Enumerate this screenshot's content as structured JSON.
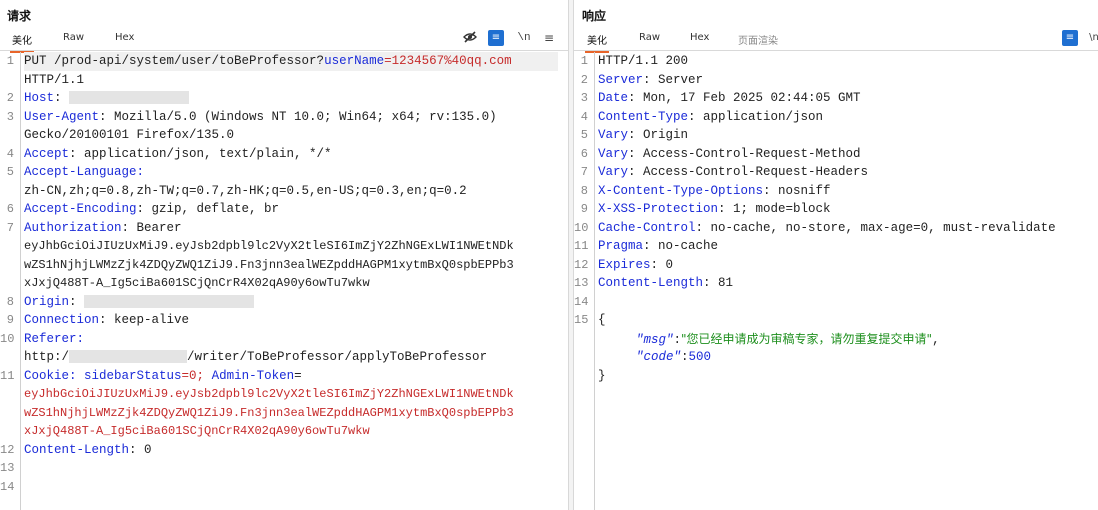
{
  "request": {
    "title": "请求",
    "tabs": [
      "美化",
      "Raw",
      "Hex"
    ],
    "line_numbers": [
      "1",
      "2",
      "3",
      "4",
      "5",
      "6",
      "7",
      "8",
      "9",
      "10",
      "11",
      "12",
      "13",
      "14"
    ],
    "lines": {
      "l1_method": "PUT /prod-api/system/user/toBeProfessor?",
      "l1_param": "userName",
      "l1_value": "=1234567%40qq.com",
      "l1_cont": "HTTP/1.1",
      "l2_key": "Host",
      "l3_key": "User-Agent",
      "l3_val": ": Mozilla/5.0 (Windows NT 10.0; Win64; x64; rv:135.0)",
      "l3_cont": "Gecko/20100101 Firefox/135.0",
      "l4_key": "Accept",
      "l4_val": ": application/json, text/plain, */*",
      "l5_key": "Accept-Language",
      "l5_cont": "zh-CN,zh;q=0.8,zh-TW;q=0.7,zh-HK;q=0.5,en-US;q=0.3,en;q=0.2",
      "l6_key": "Accept-Encoding",
      "l6_val": ": gzip, deflate, br",
      "l7_key": "Authorization",
      "l7_val": ": Bearer",
      "l7_c1": "eyJhbGciOiJIUzUxMiJ9.eyJsb2dpbl9lc2VyX2tleSI6ImZjY2ZhNGExLWI1NWEtNDk",
      "l7_c2": "wZS1hNjhjLWMzZjk4ZDQyZWQ1ZiJ9.Fn3jnn3ealWEZpddHAGPM1xytmBxQ0spbEPPb3",
      "l7_c3": "xJxjQ488T-A_Ig5ciBa601SCjQnCrR4X02qA90y6owTu7wkw",
      "l8_key": "Origin",
      "l9_key": "Connection",
      "l9_val": ": keep-alive",
      "l10_key": "Referer",
      "l10_c1": "http:/",
      "l10_c2": "/writer/ToBeProfessor/applyToBeProfessor",
      "l11_key": "Cookie",
      "l11_val": ": sidebarStatus",
      "l11_val2": "=0; ",
      "l11_key2": "Admin-Token",
      "l11_eq": "=",
      "l11_c1": "eyJhbGciOiJIUzUxMiJ9.eyJsb2dpbl9lc2VyX2tleSI6ImZjY2ZhNGExLWI1NWEtNDk",
      "l11_c2": "wZS1hNjhjLWMzZjk4ZDQyZWQ1ZiJ9.Fn3jnn3ealWEZpddHAGPM1xytmBxQ0spbEPPb3",
      "l11_c3": "xJxjQ488T-A_Ig5ciBa601SCjQnCrR4X02qA90y6owTu7wkw",
      "l12_key": "Content-Length",
      "l12_val": ": 0"
    }
  },
  "response": {
    "title": "响应",
    "tabs": [
      "美化",
      "Raw",
      "Hex",
      "页面渲染"
    ],
    "line_numbers": [
      "1",
      "2",
      "3",
      "4",
      "5",
      "6",
      "7",
      "8",
      "9",
      "10",
      "11",
      "12",
      "13",
      "14",
      "15"
    ],
    "lines": {
      "r1": "HTTP/1.1 200",
      "r2_key": "Server",
      "r2_val": ": Server",
      "r3_key": "Date",
      "r3_val": ": Mon, 17 Feb 2025 02:44:05 GMT",
      "r4_key": "Content-Type",
      "r4_val": ": application/json",
      "r5_key": "Vary",
      "r5_val": ": Origin",
      "r6_key": "Vary",
      "r6_val": ": Access-Control-Request-Method",
      "r7_key": "Vary",
      "r7_val": ": Access-Control-Request-Headers",
      "r8_key": "X-Content-Type-Options",
      "r8_val": ": nosniff",
      "r9_key": "X-XSS-Protection",
      "r9_val": ": 1; mode=block",
      "r10_key": "Cache-Control",
      "r10_val": ": no-cache, no-store, max-age=0, must-revalidate",
      "r11_key": "Pragma",
      "r11_val": ": no-cache",
      "r12_key": "Expires",
      "r12_val": ": 0",
      "r13_key": "Content-Length",
      "r13_val": ": 81",
      "r15_open": "{",
      "json_msg_key": "\"msg\"",
      "json_colon": ":",
      "json_msg_val": "\"您已经申请成为审稿专家，请勿重复提交申请\"",
      "json_comma": ",",
      "json_code_key": "\"code\"",
      "json_code_val": "500",
      "r_close": "}"
    }
  },
  "icons": {
    "hide": "eye-slash-icon",
    "wrap": "wrap-lines-icon",
    "newline": "show-newlines-icon",
    "menu": "menu-icon"
  },
  "colors": {
    "accent_tab": "#e8652a",
    "header_key": "#1b2bd8",
    "token_value": "#c62b2b",
    "json_string": "#1e8f1e",
    "icon_button": "#1f6fd1"
  }
}
